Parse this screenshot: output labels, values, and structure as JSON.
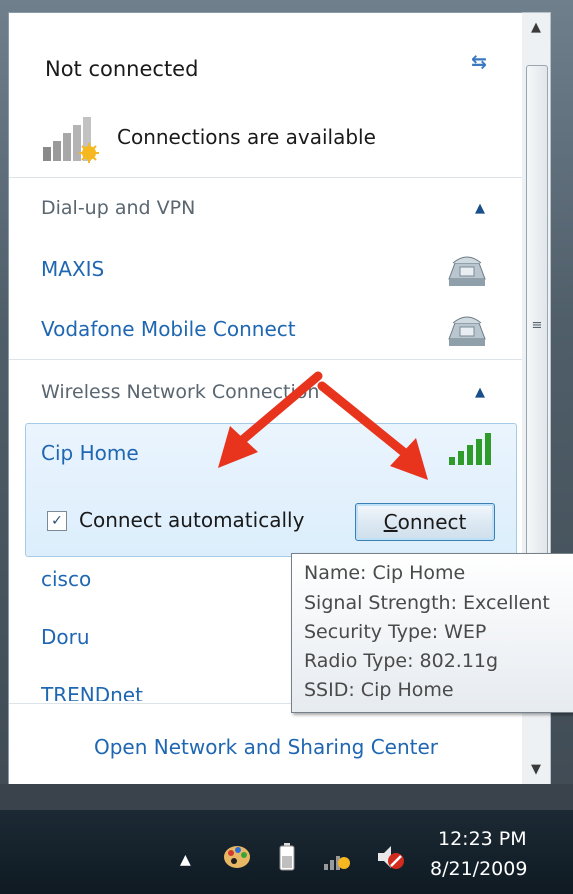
{
  "header": {
    "status": "Not connected",
    "availability": "Connections are available"
  },
  "sections": [
    {
      "label": "Dial-up and VPN",
      "items": [
        "MAXIS",
        "Vodafone Mobile Connect"
      ]
    },
    {
      "label": "Wireless Network Connection",
      "items": [
        "Cip Home",
        "cisco",
        "Doru",
        "TRENDnet"
      ]
    }
  ],
  "selected_network": {
    "name": "Cip Home",
    "auto_connect_label": "Connect automatically",
    "auto_connect_checked": true,
    "connect_button_label": "Connect"
  },
  "tooltip": {
    "lines": [
      "Name: Cip Home",
      "Signal Strength: Excellent",
      "Security Type: WEP",
      "Radio Type: 802.11g",
      "SSID: Cip Home"
    ]
  },
  "footer": {
    "link": "Open Network and Sharing Center"
  },
  "taskbar": {
    "time": "12:23 PM",
    "date": "8/21/2009"
  },
  "colors": {
    "link": "#1f67b2",
    "annotation_arrow": "#e8341c",
    "signal_green": "#2e9b2a"
  },
  "icons": [
    "refresh-icon",
    "signal-bars-icon",
    "phone-icon",
    "scroll-up-icon",
    "scroll-down-icon",
    "show-hidden-icons-icon",
    "palette-icon",
    "battery-icon",
    "network-icon",
    "volume-muted-icon"
  ]
}
